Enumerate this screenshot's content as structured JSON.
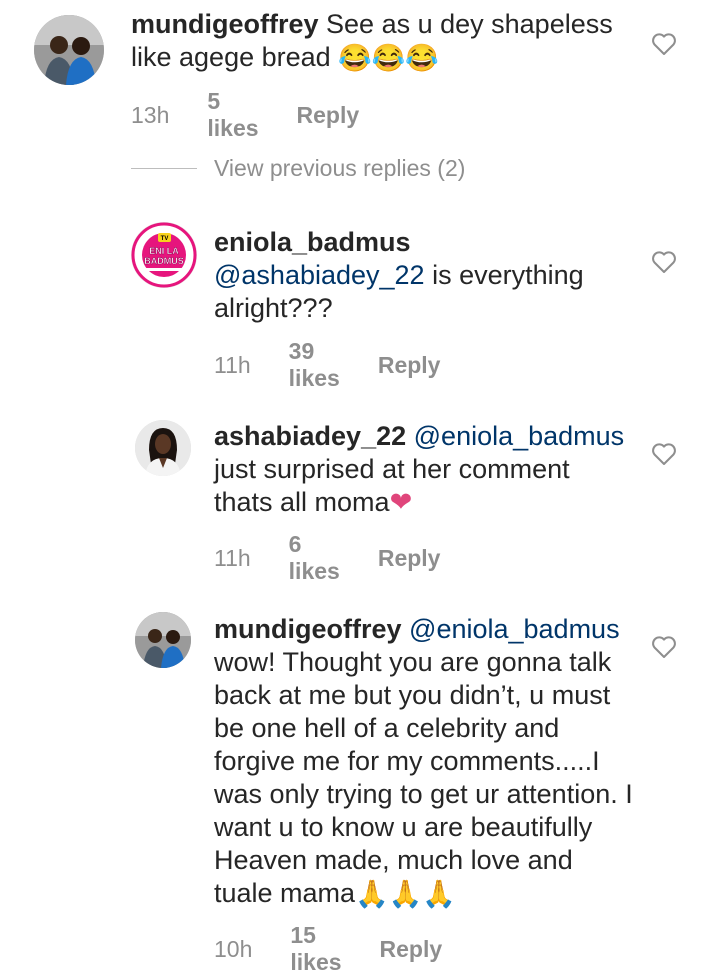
{
  "comments": [
    {
      "username": "mundigeoffrey",
      "mention": "",
      "text": "See as u dey shapeless like agege bread",
      "emoji": "😂😂😂",
      "time": "13h",
      "likes": "5 likes",
      "reply": "Reply"
    },
    {
      "username": "eniola_badmus",
      "mention": "@ashabiadey_22",
      "text": " is everything alright???",
      "emoji": "",
      "time": "11h",
      "likes": "39 likes",
      "reply": "Reply"
    },
    {
      "username": "ashabiadey_22",
      "mention": "@eniola_badmus",
      "text": "just surprised at her comment thats all moma",
      "emoji": "❤",
      "time": "11h",
      "likes": "6 likes",
      "reply": "Reply"
    },
    {
      "username": "mundigeoffrey",
      "mention": "@eniola_badmus",
      "text": "wow! Thought you are gonna talk back at me but you didn’t, u must be one hell of a celebrity and forgive me for my comments.....I was only trying to get ur attention. I want u to know u are beautifully Heaven made, much love and tuale mama",
      "emoji": "🙏🙏🙏",
      "time": "10h",
      "likes": "15 likes",
      "reply": "Reply"
    }
  ],
  "view_previous": "View previous replies (2)",
  "avatar_logo": "ENIOLA BADMUS",
  "avatar_logo_badge": "TV",
  "colors": {
    "mention": "#003569",
    "meta": "#8e8e8e",
    "heart_emoji": "#e0457b",
    "logo_pink": "#e6157d"
  },
  "icons": [
    "like-heart-icon",
    "avatar-photo",
    "eniola-badmus-logo"
  ]
}
